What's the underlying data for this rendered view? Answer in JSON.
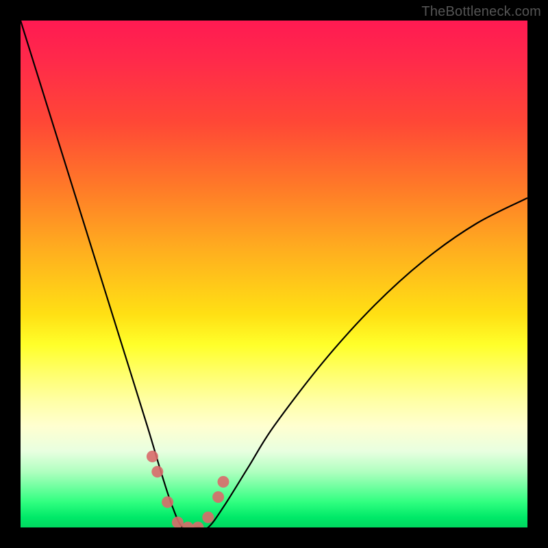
{
  "watermark": "TheBottleneck.com",
  "chart_data": {
    "type": "line",
    "title": "",
    "xlabel": "",
    "ylabel": "",
    "xlim": [
      0,
      100
    ],
    "ylim": [
      0,
      100
    ],
    "series": [
      {
        "name": "bottleneck-curve",
        "x": [
          0,
          5,
          10,
          15,
          20,
          25,
          28,
          30,
          32,
          35,
          37,
          40,
          45,
          50,
          60,
          70,
          80,
          90,
          100
        ],
        "values": [
          100,
          84,
          68,
          52,
          36,
          20,
          10,
          4,
          0,
          0,
          0,
          4,
          12,
          20,
          33,
          44,
          53,
          60,
          65
        ]
      }
    ],
    "markers": {
      "name": "highlight-points",
      "x": [
        26,
        27,
        29,
        31,
        33,
        35,
        37,
        39,
        40
      ],
      "values": [
        14,
        11,
        5,
        1,
        0,
        0,
        2,
        6,
        9
      ]
    },
    "background_gradient": [
      {
        "stop": 0.0,
        "color": "#ff1a52"
      },
      {
        "stop": 0.5,
        "color": "#ffe014"
      },
      {
        "stop": 0.8,
        "color": "#ffffd0"
      },
      {
        "stop": 1.0,
        "color": "#00d860"
      }
    ]
  }
}
